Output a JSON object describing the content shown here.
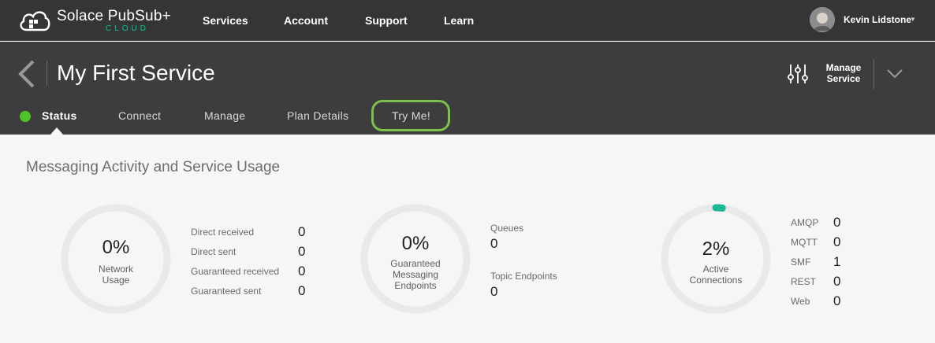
{
  "brand": {
    "name": "Solace PubSub+",
    "sub": "CLOUD",
    "accent": "#00c895"
  },
  "topnav": [
    "Services",
    "Account",
    "Support",
    "Learn"
  ],
  "user": {
    "name": "Kevin Lidstone"
  },
  "service": {
    "title": "My First Service",
    "manage_label_1": "Manage",
    "manage_label_2": "Service",
    "status_color": "#4ec32c"
  },
  "tabs": [
    "Status",
    "Connect",
    "Manage",
    "Plan Details",
    "Try Me!"
  ],
  "highlight_color": "#7cc24a",
  "main": {
    "section_title": "Messaging Activity and Service Usage",
    "gauges": [
      {
        "percent": "0%",
        "value": 0,
        "label_1": "Network",
        "label_2": "Usage",
        "label_3": ""
      },
      {
        "percent": "0%",
        "value": 0,
        "label_1": "Guaranteed",
        "label_2": "Messaging",
        "label_3": "Endpoints"
      },
      {
        "percent": "2%",
        "value": 0.02,
        "label_1": "Active",
        "label_2": "Connections",
        "label_3": ""
      }
    ],
    "network_stats": [
      {
        "label": "Direct received",
        "value": "0"
      },
      {
        "label": "Direct sent",
        "value": "0"
      },
      {
        "label": "Guaranteed received",
        "value": "0"
      },
      {
        "label": "Guaranteed sent",
        "value": "0"
      }
    ],
    "endpoint_stats": [
      {
        "label": "Queues",
        "value": "0"
      },
      {
        "label": "Topic Endpoints",
        "value": "0"
      }
    ],
    "connection_stats": [
      {
        "label": "AMQP",
        "value": "0"
      },
      {
        "label": "MQTT",
        "value": "0"
      },
      {
        "label": "SMF",
        "value": "1"
      },
      {
        "label": "REST",
        "value": "0"
      },
      {
        "label": "Web",
        "value": "0"
      }
    ]
  }
}
